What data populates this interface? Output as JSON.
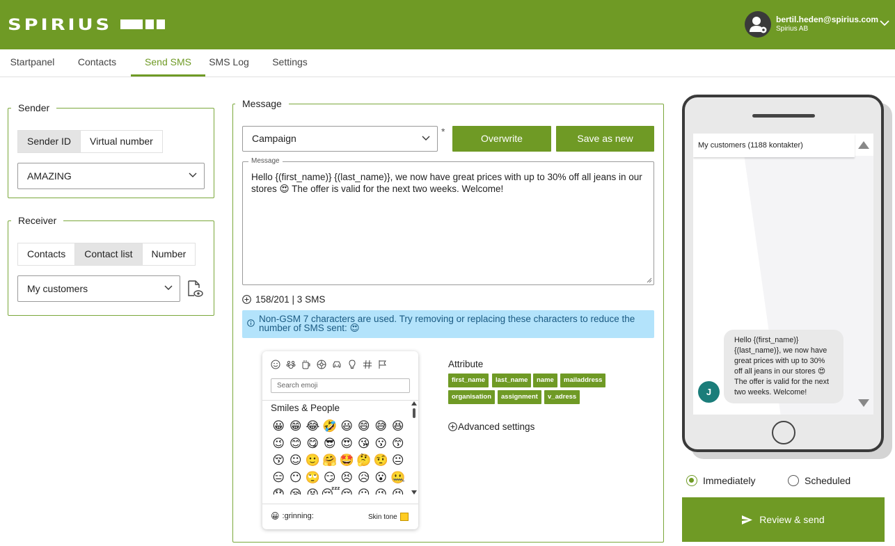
{
  "header": {
    "logo_text": "SPIRIUS",
    "user_email": "bertil.heden@spirius.com",
    "user_org": "Spirius AB"
  },
  "nav": {
    "tabs": [
      {
        "label": "Startpanel"
      },
      {
        "label": "Contacts"
      },
      {
        "label": "Send SMS",
        "active": true
      },
      {
        "label": "SMS Log"
      },
      {
        "label": "Settings"
      }
    ]
  },
  "sender": {
    "legend": "Sender",
    "options": [
      "Sender ID",
      "Virtual number"
    ],
    "selected_option": "Sender ID",
    "value": "AMAZING"
  },
  "receiver": {
    "legend": "Receiver",
    "options": [
      "Contacts",
      "Contact list",
      "Number"
    ],
    "selected_option": "Contact list",
    "value": "My customers"
  },
  "message": {
    "legend": "Message",
    "template_value": "Campaign",
    "required_mark": "*",
    "overwrite_label": "Overwrite",
    "save_as_new_label": "Save as new",
    "field_label": "Message",
    "text": "Hello {(first_name)} {(last_name)}, we now have great prices with up to 30% off all jeans in our stores 😍 The offer is valid for the next two weeks. Welcome!",
    "counter": "158/201 | 3 SMS",
    "alert": "Non-GSM 7 characters are used. Try removing or replacing these characters to reduce the number of SMS sent: 😍"
  },
  "emoji_picker": {
    "search_placeholder": "Search emoji",
    "section_title": "Smiles & People",
    "emojis": [
      "😀",
      "😁",
      "😂",
      "🤣",
      "😃",
      "😄",
      "😅",
      "😆",
      "😉",
      "😊",
      "😋",
      "😎",
      "😍",
      "😘",
      "😗",
      "😙",
      "😚",
      "☺",
      "🙂",
      "🤗",
      "🤩",
      "🤔",
      "🤨",
      "😐",
      "😑",
      "😶",
      "🙄",
      "😏",
      "😣",
      "😥",
      "😮",
      "🤐",
      "😯",
      "😪",
      "😫",
      "😴",
      "😌",
      "😛",
      "😜",
      "😝"
    ],
    "preview_emoji": "😀",
    "preview_name": ":grinning:",
    "skin_tone_label": "Skin tone"
  },
  "attributes": {
    "title": "Attribute",
    "tags": [
      "first_name",
      "last_name",
      "name",
      "mailaddress",
      "organisation",
      "assignment",
      "v_adress"
    ],
    "advanced_label": "Advanced settings"
  },
  "preview": {
    "header": "My customers (1188 kontakter)",
    "bubble_text": "Hello {(first_name)} {(last_name)}, we now have great prices with up to 30% off all jeans in our stores 😍 The offer is valid for the next two weeks. Welcome!",
    "avatar_initial": "J"
  },
  "schedule": {
    "immediately_label": "Immediately",
    "scheduled_label": "Scheduled",
    "selected": "Immediately"
  },
  "review_label": "Review & send",
  "colors": {
    "brand": "#6f9a25",
    "alert_bg": "#b3e3fb",
    "avatar_bg": "#1b7d7a"
  }
}
